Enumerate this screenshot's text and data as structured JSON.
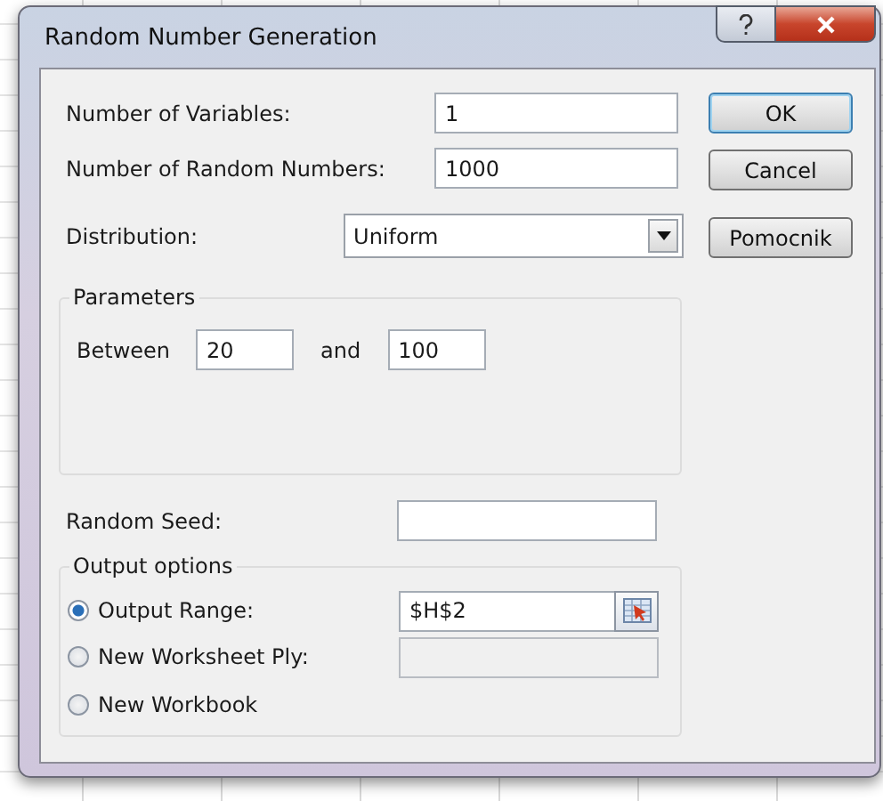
{
  "window": {
    "title": "Random Number Generation"
  },
  "fields": [
    {
      "label": "Number of Variables:",
      "value": "1"
    },
    {
      "label": "Number of Random Numbers:",
      "value": "1000"
    }
  ],
  "distribution": {
    "label": "Distribution:",
    "value": "Uniform"
  },
  "buttons": [
    {
      "label": "OK",
      "default": true
    },
    {
      "label": "Cancel",
      "default": false
    },
    {
      "label": "Pomocnik",
      "default": false
    }
  ],
  "parameters": {
    "title": "Parameters",
    "between_label": "Between",
    "from": "20",
    "and_label": "and",
    "to": "100"
  },
  "random_seed": {
    "label": "Random Seed:"
  },
  "output_options": {
    "title": "Output options",
    "options": [
      {
        "kind": "range",
        "label": "Output Range:",
        "selected": true,
        "value": "$H$2",
        "disabled": false
      },
      {
        "kind": "text",
        "label": "New Worksheet Ply:",
        "selected": false,
        "disabled": true
      },
      {
        "kind": "none",
        "label": "New Workbook",
        "selected": false
      }
    ]
  }
}
